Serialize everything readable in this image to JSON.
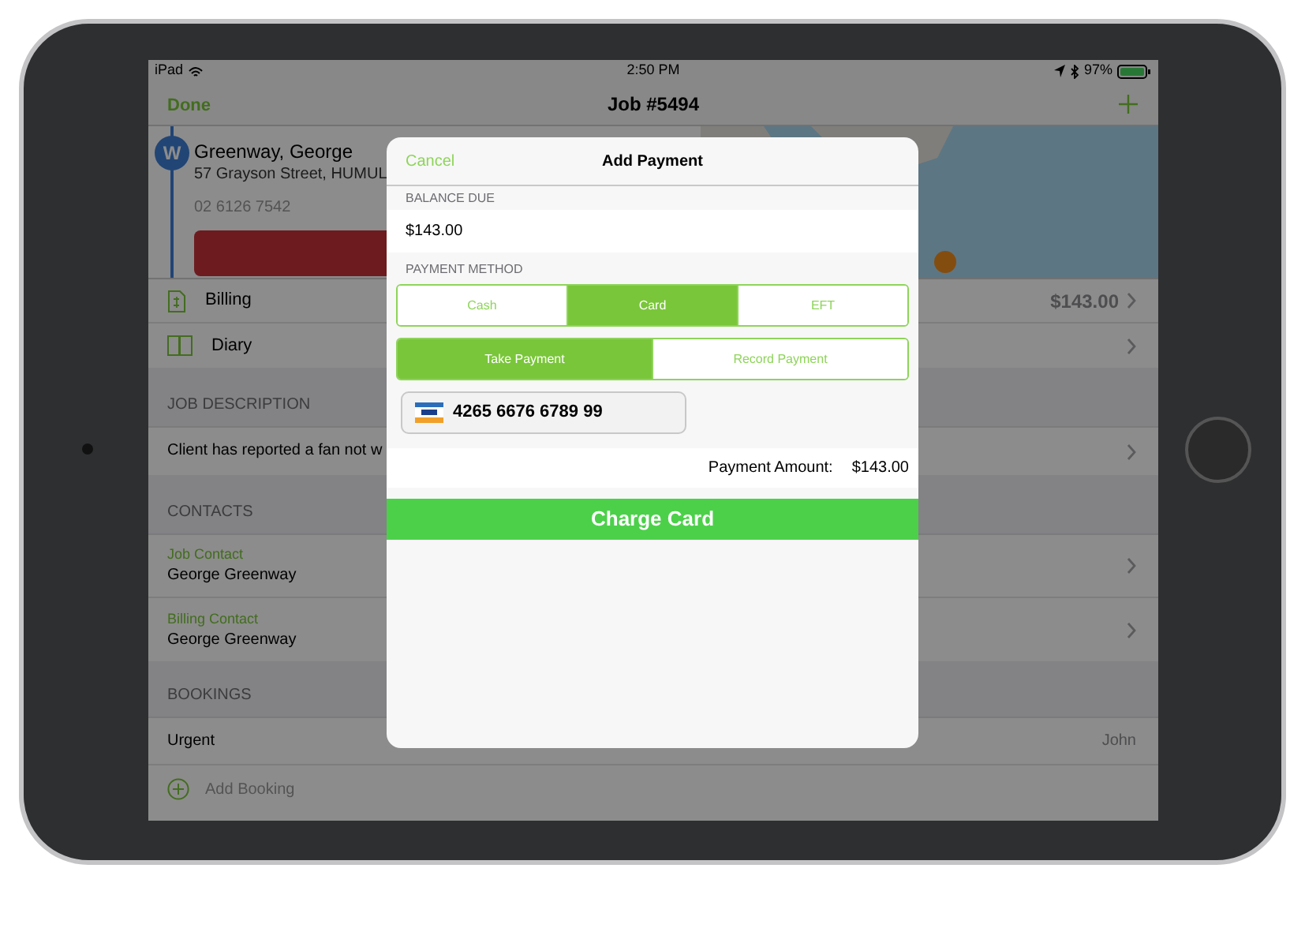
{
  "status_bar": {
    "device": "iPad",
    "time": "2:50 PM",
    "battery": "97%"
  },
  "nav": {
    "left": "Done",
    "title": "Job #5494"
  },
  "customer": {
    "badge": "W",
    "name": "Greenway, George",
    "address": "57 Grayson Street, HUMUL",
    "phone": "02 6126 7542"
  },
  "menu_rows": [
    {
      "label": "Billing",
      "value": "$143.00"
    },
    {
      "label": "Diary"
    }
  ],
  "sections": [
    {
      "title": "JOB DESCRIPTION",
      "rows": [
        {
          "kind": "link",
          "text": "Client has reported a fan not w"
        }
      ]
    },
    {
      "title": "CONTACTS",
      "rows": [
        {
          "kind": "link",
          "label": "Job Contact",
          "text": "George Greenway"
        },
        {
          "kind": "link",
          "label": "Billing Contact",
          "text": "George Greenway"
        }
      ]
    },
    {
      "title": "BOOKINGS",
      "rows": [
        {
          "kind": "plain",
          "text": "Urgent",
          "value": "John"
        },
        {
          "kind": "add",
          "text": "Add Booking"
        }
      ]
    }
  ],
  "modal": {
    "cancel": "Cancel",
    "title": "Add Payment",
    "balance_label": "BALANCE DUE",
    "balance": "$143.00",
    "method_label": "PAYMENT METHOD",
    "methods": [
      {
        "label": "Cash",
        "selected": false
      },
      {
        "label": "Card",
        "selected": true
      },
      {
        "label": "EFT",
        "selected": false
      }
    ],
    "modes": [
      {
        "label": "Take Payment",
        "selected": true
      },
      {
        "label": "Record Payment",
        "selected": false
      }
    ],
    "card_number": "4265 6676 6789 99",
    "amount_label": "Payment Amount:",
    "amount": "$143.00",
    "charge_button": "Charge Card"
  }
}
